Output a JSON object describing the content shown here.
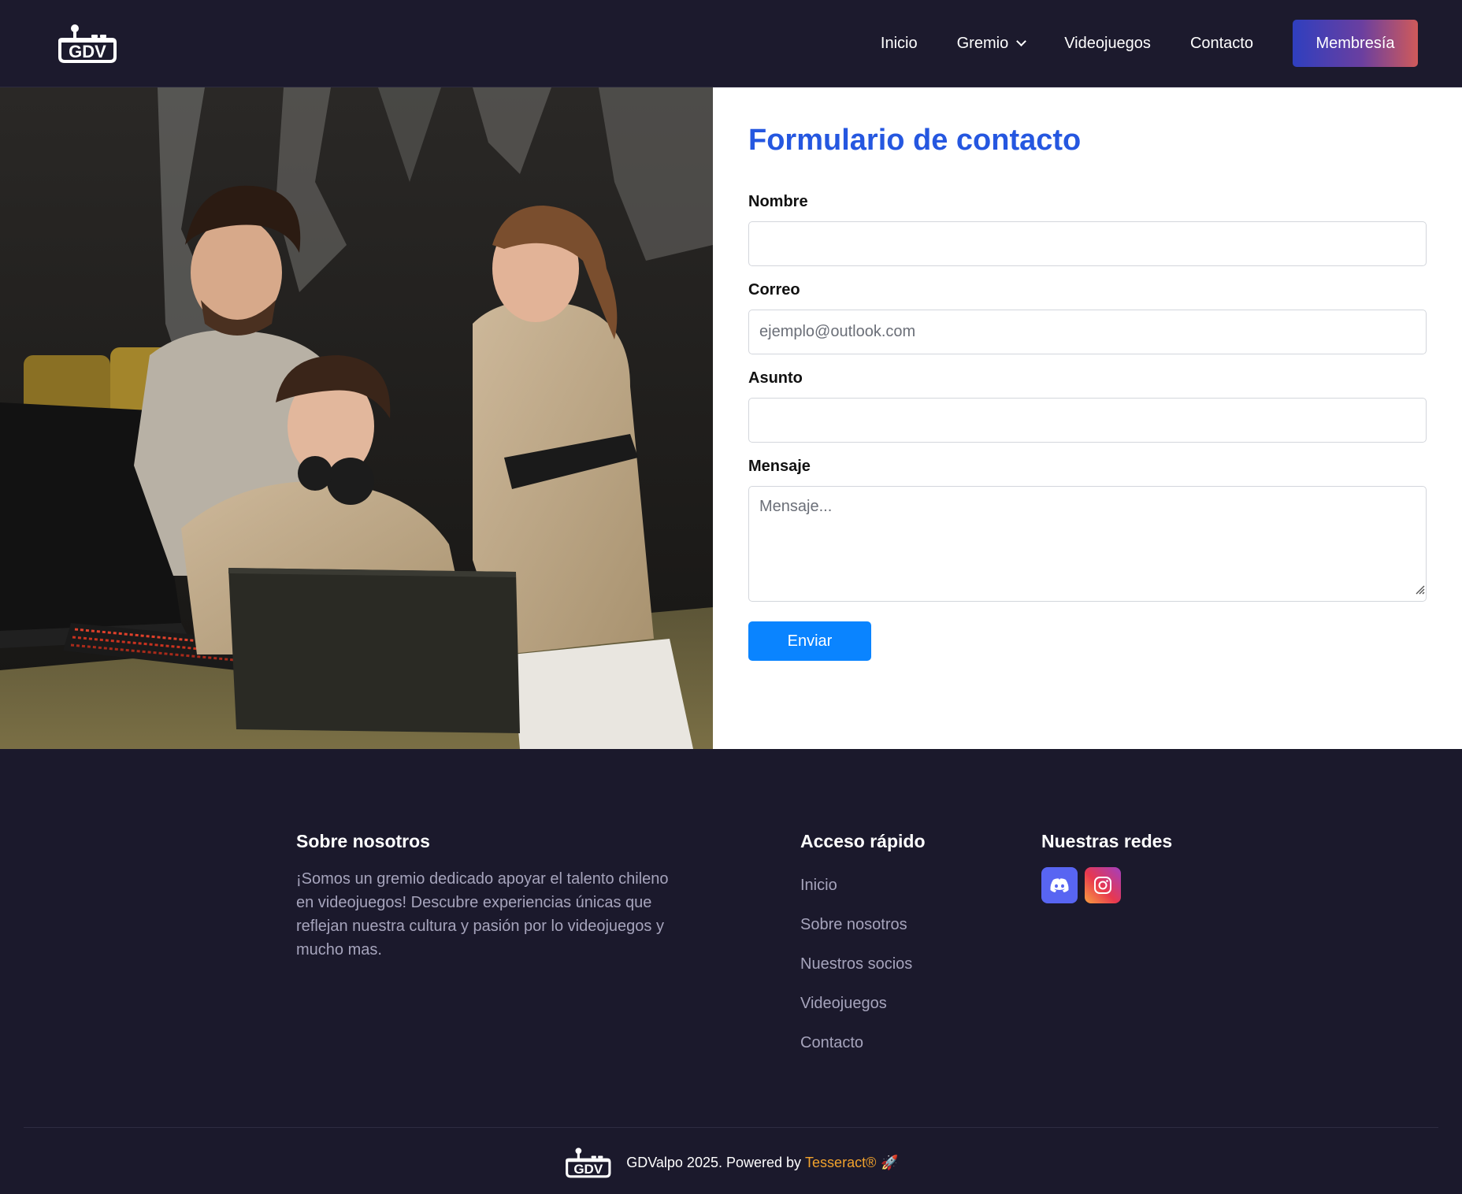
{
  "brand": {
    "logo_text": "GDV"
  },
  "nav": {
    "items": [
      "Inicio",
      "Gremio",
      "Videojuegos",
      "Contacto"
    ],
    "membership": "Membresía"
  },
  "form": {
    "title": "Formulario de contacto",
    "name_label": "Nombre",
    "name_value": "",
    "email_label": "Correo",
    "email_placeholder": "ejemplo@outlook.com",
    "subject_label": "Asunto",
    "subject_value": "",
    "message_label": "Mensaje",
    "message_placeholder": "Mensaje...",
    "submit": "Enviar"
  },
  "footer": {
    "about_title": "Sobre nosotros",
    "about_text": "¡Somos un gremio dedicado apoyar el talento chileno en videojuegos! Descubre experiencias únicas que reflejan nuestra cultura y pasión por lo videojuegos y mucho mas.",
    "quick_title": "Acceso rápido",
    "quick_links": [
      "Inicio",
      "Sobre nosotros",
      "Nuestros socios",
      "Videojuegos",
      "Contacto"
    ],
    "social_title": "Nuestras redes",
    "copyright": "GDValpo 2025. Powered by",
    "powered_by": "Tesseract®",
    "rocket": "🚀"
  },
  "colors": {
    "navbar_bg": "#1c1a2d",
    "accent_title": "#2557e0",
    "submit_bg": "#0a84ff",
    "membership_gradient": [
      "#2f3fbf",
      "#d05a5a"
    ],
    "footer_text": "#a6a4bc",
    "tesseract": "#f1a22c"
  },
  "icons": {
    "nav_dropdown": "chevron-down-icon",
    "social": [
      "discord-icon",
      "instagram-icon"
    ]
  }
}
